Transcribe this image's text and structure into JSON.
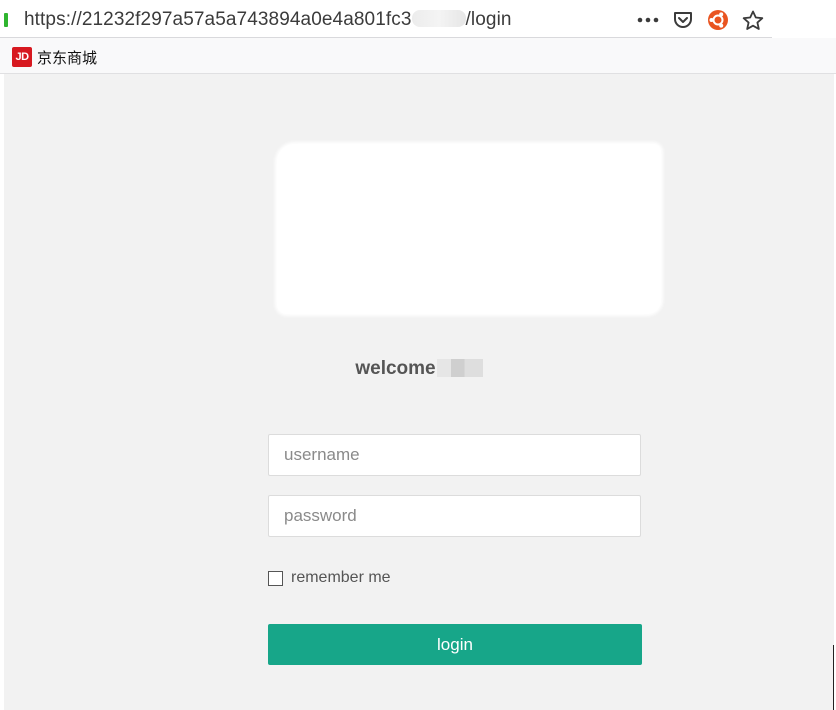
{
  "browser": {
    "url_prefix": "https://21232f297a57a5a743894a0e4a801fc3",
    "url_suffix": "/login",
    "toolbar_icons": [
      "more-icon",
      "pocket-icon",
      "ubuntu-icon",
      "bookmark-star-icon"
    ]
  },
  "bookmarks": {
    "items": [
      {
        "logo_text": "JD",
        "label": "京东商城"
      }
    ]
  },
  "login": {
    "welcome": "welcome",
    "username_placeholder": "username",
    "password_placeholder": "password",
    "remember_label": "remember me",
    "remember_checked": false,
    "button_label": "login"
  },
  "colors": {
    "accent": "#17a689",
    "page_background": "#f2f2f2",
    "url_secure_indicator": "#2fb52f",
    "jd_brand": "#d71920"
  }
}
